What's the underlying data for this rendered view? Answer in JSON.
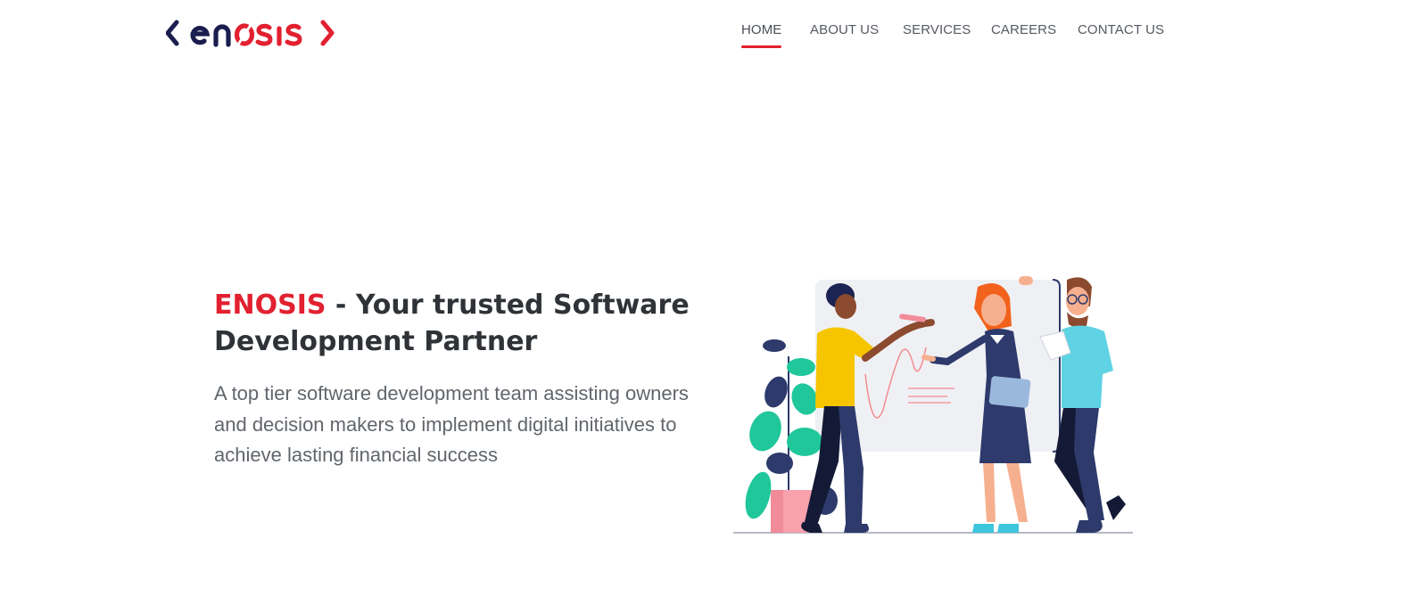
{
  "logo": {
    "text": "enosis",
    "brand_color": "#e2202f",
    "dark_color": "#1a1d4e"
  },
  "nav": {
    "items": [
      {
        "label": "HOME",
        "active": true
      },
      {
        "label": "ABOUT US",
        "active": false
      },
      {
        "label": "SERVICES",
        "active": false
      },
      {
        "label": "CAREERS",
        "active": false
      },
      {
        "label": "CONTACT US",
        "active": false
      }
    ]
  },
  "hero": {
    "brand": "ENOSIS",
    "title_rest": " - Your trusted Software Development Partner",
    "description": "A top tier software development team assisting owners and decision makers to implement digital initiatives to achieve lasting financial success"
  },
  "colors": {
    "accent": "#e2202f",
    "heading": "#2f3337",
    "body_text": "#61666c"
  }
}
